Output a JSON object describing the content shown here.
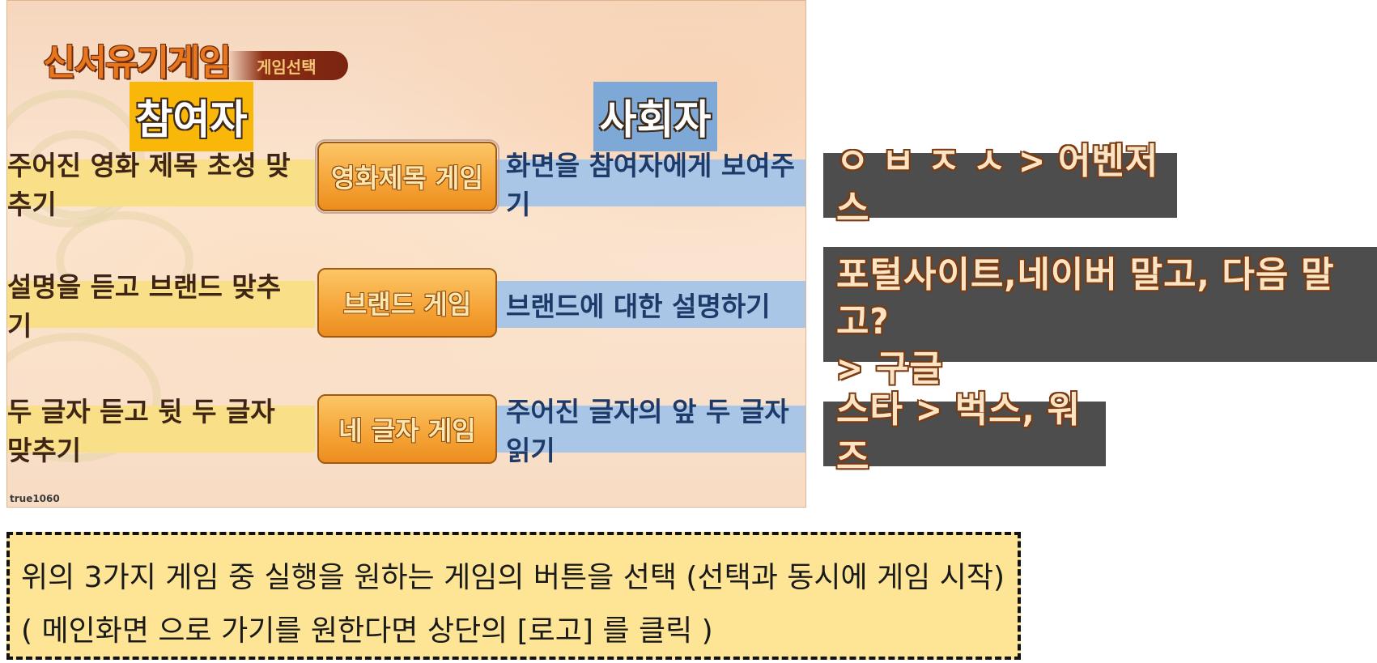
{
  "logo": {
    "title": "신서유기게임",
    "subtitle": "게임선택"
  },
  "headers": {
    "participant": "참여자",
    "host": "사회자"
  },
  "games": [
    {
      "participant_task": "주어진 영화 제목 초성 맞추기",
      "button_label": "영화제목 게임",
      "host_task": "화면을 참여자에게 보여주기"
    },
    {
      "participant_task": "설명을 듣고 브랜드 맞추기",
      "button_label": "브랜드 게임",
      "host_task": "브랜드에 대한 설명하기"
    },
    {
      "participant_task": "두 글자 듣고 뒷 두 글자 맞추기",
      "button_label": "네 글자 게임",
      "host_task": "주어진 글자의 앞 두 글자 읽기"
    }
  ],
  "watermark": "true1060",
  "answers": [
    "ㅇ ㅂ ㅈ ㅅ > 어벤저스",
    "포털사이트,네이버 말고, 다음 말고?\n> 구글",
    "스타 > 벅스, 워즈"
  ],
  "instructions": {
    "line1": "위의 3가지 게임 중 실행을 원하는 게임의 버튼을 선택 (선택과 동시에 게임 시작)",
    "line2": "( 메인화면 으로 가기를 원한다면 상단의 [로고] 를 클릭 )"
  },
  "colors": {
    "participant_header": "#f9b709",
    "host_header": "#7ea9d6",
    "participant_band": "#f8df88",
    "host_band": "#a9c6e6",
    "button": "#f6a63a",
    "answer_box": "#4d4d4d",
    "instruction_box": "#fde595"
  }
}
